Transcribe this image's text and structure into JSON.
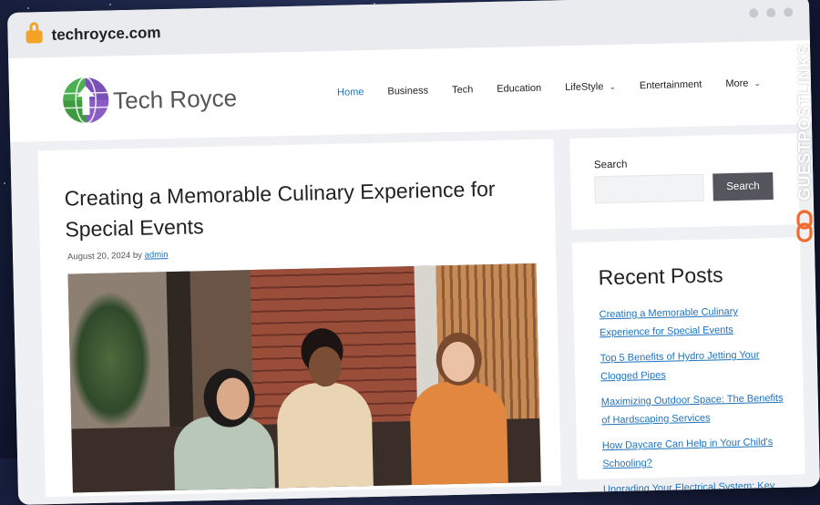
{
  "browser": {
    "url": "techroyce.com"
  },
  "site": {
    "logo_text": "Tech Royce",
    "accent_color": "#1e73be",
    "nav": [
      {
        "label": "Home",
        "active": true,
        "dropdown": false
      },
      {
        "label": "Business",
        "active": false,
        "dropdown": false
      },
      {
        "label": "Tech",
        "active": false,
        "dropdown": false
      },
      {
        "label": "Education",
        "active": false,
        "dropdown": false
      },
      {
        "label": "LifeStyle",
        "active": false,
        "dropdown": true
      },
      {
        "label": "Entertainment",
        "active": false,
        "dropdown": false
      },
      {
        "label": "More",
        "active": false,
        "dropdown": true
      }
    ]
  },
  "article": {
    "title": "Creating a Memorable Culinary Experience for Special Events",
    "date": "August 20, 2024",
    "by": "by",
    "author": "admin"
  },
  "sidebar": {
    "search_label": "Search",
    "search_button": "Search",
    "search_value": "",
    "recent_title": "Recent Posts",
    "recent_posts": [
      "Creating a Memorable Culinary Experience for Special Events",
      "Top 5 Benefits of Hydro Jetting Your Clogged Pipes",
      "Maximizing Outdoor Space: The Benefits of Hardscaping Services",
      "How Daycare Can Help in Your Child's Schooling?",
      "Upgrading Your Electrical System: Key"
    ]
  },
  "watermark": {
    "text": "GUESTPOSTLINKS",
    "icon": "chain-link-icon",
    "icon_color": "#f26a2e"
  }
}
